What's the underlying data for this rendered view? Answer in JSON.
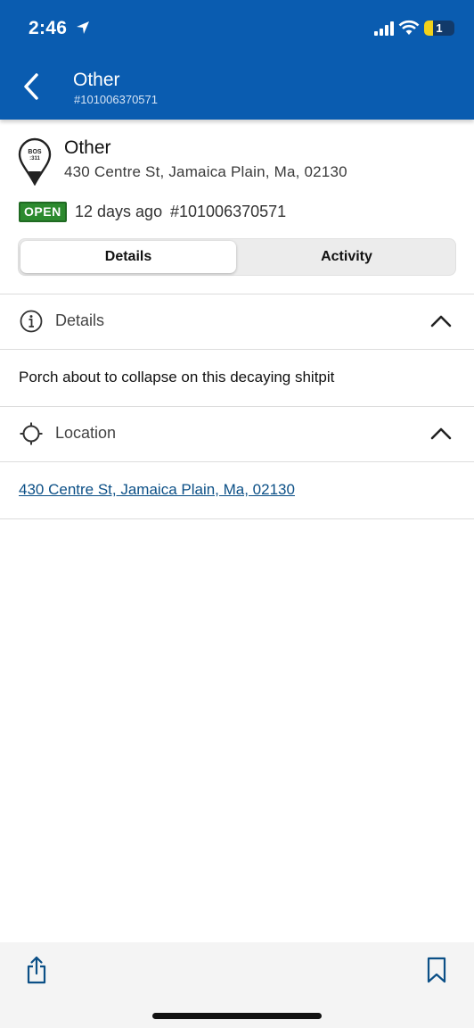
{
  "status_bar": {
    "time": "2:46",
    "battery": "1",
    "icons": [
      "location-arrow-icon",
      "signal-icon",
      "wifi-icon",
      "battery-icon"
    ]
  },
  "header": {
    "title": "Other",
    "subtitle": "#101006370571",
    "back_icon": "chevron-left-icon",
    "background_color": "#0a5cb0"
  },
  "request": {
    "title": "Other",
    "address": "430 Centre St, Jamaica Plain, Ma, 02130",
    "pin_label_line1": "BOS",
    "pin_label_line2": ":311",
    "status": "OPEN",
    "status_color": "#2c8a2e",
    "age": "12 days ago",
    "number": "#101006370571"
  },
  "tabs": [
    {
      "label": "Details",
      "selected": true
    },
    {
      "label": "Activity",
      "selected": false
    }
  ],
  "sections": {
    "details": {
      "label": "Details",
      "icon": "info-icon",
      "expanded": true,
      "body": "Porch about to collapse on this decaying shitpit"
    },
    "location": {
      "label": "Location",
      "icon": "crosshair-icon",
      "expanded": true,
      "link": "430 Centre St, Jamaica Plain, Ma, 02130"
    }
  },
  "bottom_bar": {
    "share_icon": "share-icon",
    "bookmark_icon": "bookmark-icon"
  }
}
